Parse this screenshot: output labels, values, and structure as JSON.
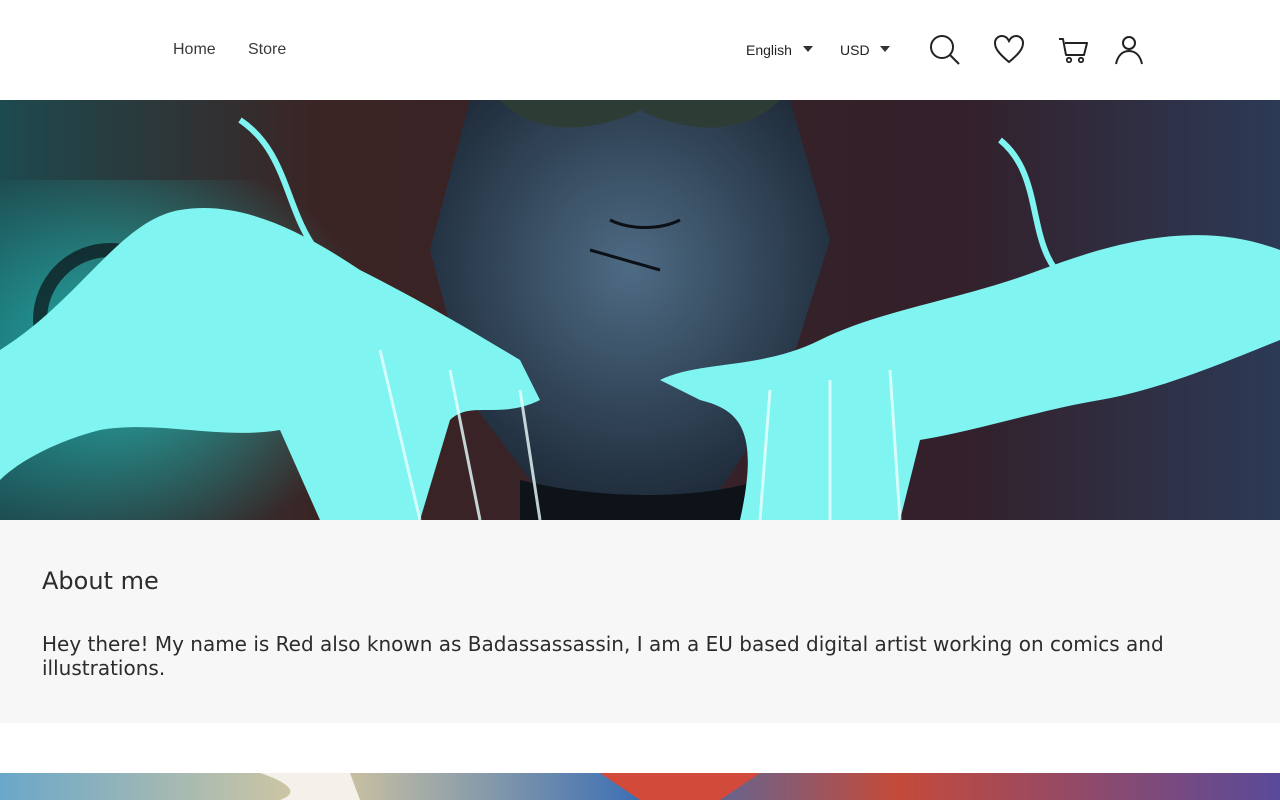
{
  "nav": {
    "home": "Home",
    "store": "Store"
  },
  "selectors": {
    "language": "English",
    "currency": "USD"
  },
  "icons": [
    "search-icon",
    "heart-icon",
    "cart-icon",
    "user-icon"
  ],
  "hero": {
    "palette": {
      "glow": "#7ff4f0",
      "dark": "#1b2a33",
      "bg": "#3a2222"
    }
  },
  "about": {
    "title": "About me",
    "text": "Hey there! My name is Red also known as Badassassassin, I am a EU based digital artist working on comics and illustrations."
  }
}
